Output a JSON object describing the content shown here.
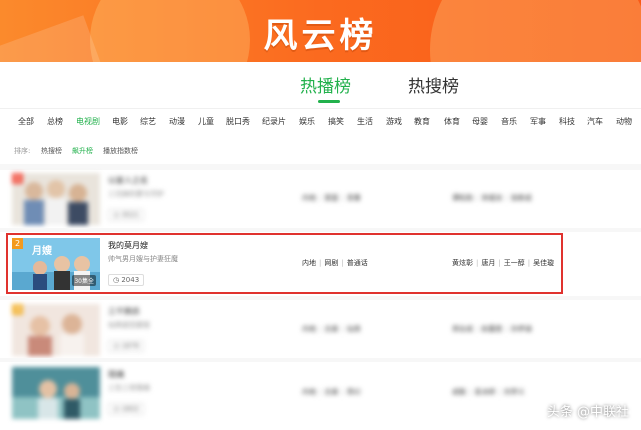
{
  "banner": {
    "title": "风云榜"
  },
  "tabs": [
    {
      "label": "热播榜",
      "active": true
    },
    {
      "label": "热搜榜",
      "active": false
    }
  ],
  "categories": [
    "全部",
    "总榜",
    "电视剧",
    "电影",
    "综艺",
    "动漫",
    "儿童",
    "脱口秀",
    "纪录片",
    "娱乐",
    "搞笑",
    "生活",
    "游戏",
    "教育",
    "体育",
    "母婴",
    "音乐",
    "军事",
    "科技",
    "汽车",
    "动物"
  ],
  "active_category": "电视剧",
  "sort": {
    "label": "排序:",
    "options": [
      "热搜榜",
      "飙升榜",
      "播放指数榜"
    ],
    "active": "飙升榜"
  },
  "rows": [
    {
      "rank": "1",
      "name": "以家人之名",
      "desc": "三兄妹的爱与守护",
      "plays": "3521",
      "tags": [
        "内地",
        "家庭",
        "青春"
      ],
      "actors": [
        "谭松韵",
        "宋威龙",
        "张新成"
      ],
      "blurred": true
    },
    {
      "rank": "2",
      "name": "我的莫月嫂",
      "desc": "帅气男月嫂与护妻狂魔",
      "plays": "2043",
      "ep_badge": "30集全",
      "tags": [
        "内地",
        "网剧",
        "普通话"
      ],
      "actors": [
        "黄炫彰",
        "唐月",
        "王一醇",
        "吴佳璇"
      ],
      "blurred": false
    },
    {
      "rank": "3",
      "name": "三千鸦杀",
      "desc": "仙侠虐恋甜宠",
      "plays": "1876",
      "tags": [
        "内地",
        "古装",
        "仙侠"
      ],
      "actors": [
        "郑业成",
        "赵露思",
        "孙伊涵"
      ],
      "blurred": true
    },
    {
      "rank": "4",
      "name": "琉璃",
      "desc": "三生三世情缘",
      "plays": "1602",
      "tags": [
        "内地",
        "古装",
        "奇幻"
      ],
      "actors": [
        "成毅",
        "袁冰妍",
        "刘学义"
      ],
      "blurred": true
    }
  ],
  "watermark": "头条 @中联社",
  "colors": {
    "accent": "#22b14c",
    "banner": "#fb6a1f",
    "highlight": "#e0322e"
  }
}
